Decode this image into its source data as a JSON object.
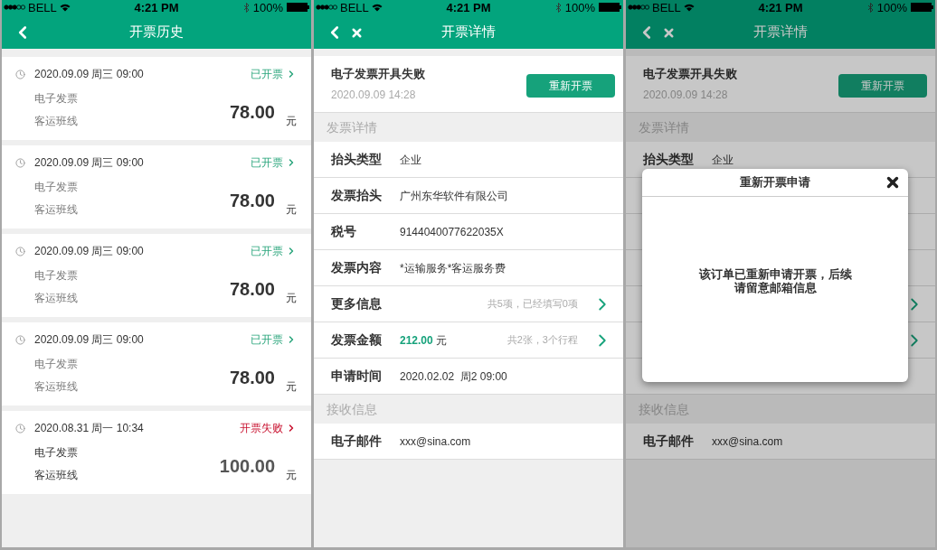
{
  "history_screen": {
    "status_bar": {
      "carrier": "BELL",
      "time": "4:21 PM",
      "battery": "100%"
    },
    "header": {
      "title": "开票历史"
    },
    "records": [
      {
        "kind": "issued",
        "datetime": "2020.09.09 周三 09:00",
        "status": "已开票",
        "invoice_type": "电子发票",
        "route": "客运班线",
        "amount": "78.00",
        "unit": "元"
      },
      {
        "kind": "issued",
        "datetime": "2020.09.09 周三 09:00",
        "status": "已开票",
        "invoice_type": "电子发票",
        "route": "客运班线",
        "amount": "78.00",
        "unit": "元"
      },
      {
        "kind": "issued",
        "datetime": "2020.09.09 周三 09:00",
        "status": "已开票",
        "invoice_type": "电子发票",
        "route": "客运班线",
        "amount": "78.00",
        "unit": "元"
      },
      {
        "kind": "issued",
        "datetime": "2020.09.09 周三 09:00",
        "status": "已开票",
        "invoice_type": "电子发票",
        "route": "客运班线",
        "amount": "78.00",
        "unit": "元"
      },
      {
        "kind": "failed",
        "datetime": "2020.08.31 周一 10:34",
        "status": "开票失败",
        "invoice_type": "电子发票",
        "route": "客运班线",
        "amount": "100.00",
        "unit": "元"
      }
    ]
  },
  "detail_screen": {
    "status_bar": {
      "carrier": "BELL",
      "time": "4:21 PM",
      "battery": "100%"
    },
    "header": {
      "title": "开票详情"
    },
    "notice": {
      "title": "电子发票开具失败",
      "time": "2020.09.09 14:28",
      "button": "重新开票"
    },
    "sections": [
      {
        "title": "发票详情",
        "rows": [
          {
            "kind": "plain",
            "label": "抬头类型",
            "value": "企业"
          },
          {
            "kind": "plain",
            "label": "发票抬头",
            "value": "广州东华软件有限公司"
          },
          {
            "kind": "plain",
            "label": "税号",
            "value": "9144040077622035X"
          },
          {
            "kind": "plain",
            "label": "发票内容",
            "value": "*运输服务*客运服务费"
          },
          {
            "kind": "link",
            "label": "更多信息",
            "note": "共5项，已经填写0项"
          },
          {
            "kind": "amount",
            "label": "发票金额",
            "amount": "212.00",
            "unit": "元",
            "note": "共2张，3个行程"
          },
          {
            "kind": "plain",
            "label": "申请时间",
            "value": "2020.02.02  周2 09:00"
          }
        ]
      },
      {
        "title": "接收信息",
        "rows": [
          {
            "kind": "plain",
            "label": "电子邮件",
            "value": "xxx@sina.com"
          }
        ]
      }
    ]
  },
  "dialog_screen": {
    "status_bar": {
      "carrier": "BELL",
      "time": "4:21 PM",
      "battery": "100%"
    },
    "header": {
      "title": "开票详情"
    },
    "notice": {
      "title": "电子发票开具失败",
      "time": "2020.09.09 14:28",
      "button": "重新开票"
    },
    "sections": [
      {
        "title": "发票详情",
        "rows": [
          {
            "kind": "plain",
            "label": "抬头类型",
            "value": "企业"
          },
          {
            "kind": "plain"
          },
          {
            "kind": "plain"
          },
          {
            "kind": "plain"
          },
          {
            "kind": "link"
          },
          {
            "kind": "amount"
          },
          {
            "kind": "plain"
          }
        ]
      },
      {
        "title": "接收信息",
        "rows": [
          {
            "kind": "plain",
            "label": "电子邮件",
            "value": "xxx@sina.com"
          }
        ]
      }
    ],
    "dialog": {
      "title": "重新开票申请",
      "message_lines": [
        "该订单已重新申请开票，后续",
        "请留意邮箱信息"
      ]
    }
  }
}
